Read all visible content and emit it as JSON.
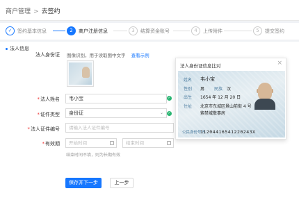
{
  "breadcrumb": {
    "parent": "商户管理",
    "separator": ">",
    "current": "去签约"
  },
  "steps": [
    {
      "num": "✓",
      "label": "签约基本信息"
    },
    {
      "num": "2",
      "label": "商户注册信息"
    },
    {
      "num": "3",
      "label": "结算资金账号"
    },
    {
      "num": "4",
      "label": "上传附件"
    },
    {
      "num": "5",
      "label": "提交签约"
    }
  ],
  "section": {
    "title": "法人信息"
  },
  "idcard_upload": {
    "label": "法人身份证",
    "hint": "图像识别，用于读取图中文字",
    "sample_link": "查看示例"
  },
  "form": {
    "name": {
      "label": "法人姓名",
      "value": "韦小宝"
    },
    "cert_type": {
      "label": "证件类型",
      "value": "身份证"
    },
    "cert_no": {
      "label": "法人证件编号",
      "placeholder": "请输入法人证件编号"
    },
    "validity": {
      "label": "有效期",
      "start_placeholder": "开始时间",
      "end_placeholder": "结束时间",
      "hint": "结束时间不填，则为长期有效"
    }
  },
  "buttons": {
    "save_next": "保存并下一步",
    "prev": "上一步"
  },
  "preview": {
    "title": "法人身份证信息比对",
    "close": "×",
    "card": {
      "name_label": "姓名",
      "name": "韦小宝",
      "gender_label": "性别",
      "gender": "男",
      "ethnicity_label": "民族",
      "ethnicity": "汉",
      "birth_label": "出生",
      "birth": "1654 年 12 月 20 日",
      "address_label": "住址",
      "address_line1": "北京市东城区景山前街 4 号",
      "address_line2": "紫禁城敬事房",
      "id_label": "公民身份号码",
      "id_number": "11204416541220243X"
    }
  },
  "colors": {
    "primary": "#1677ff",
    "success": "#2bb673",
    "required": "#e33333"
  }
}
